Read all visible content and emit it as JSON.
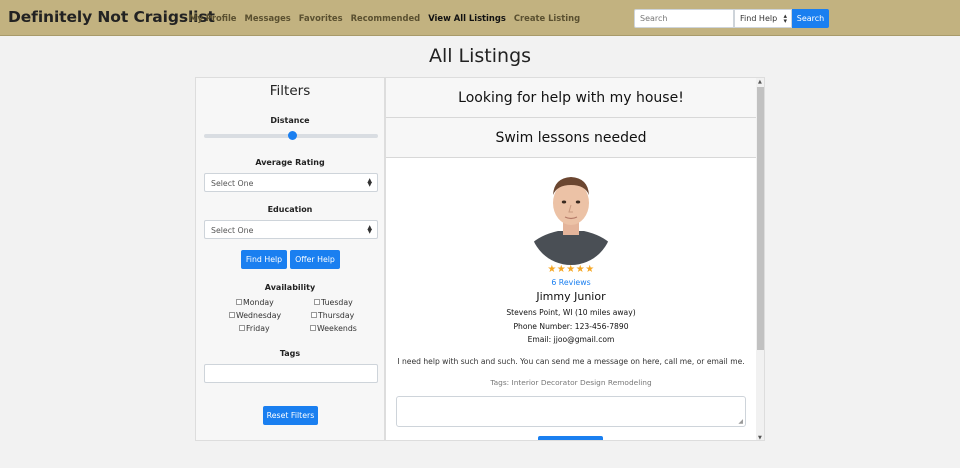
{
  "nav": {
    "brand": "Definitely Not Craigslist",
    "links": [
      "My Profile",
      "Messages",
      "Favorites",
      "Recommended",
      "View All Listings",
      "Create Listing"
    ],
    "active_link": "View All Listings",
    "search_placeholder": "Search",
    "search_type": "Find Help",
    "search_button": "Search",
    "bar_color": "#c2b280",
    "accent_color": "#1a7ff0"
  },
  "page_title": "All Listings",
  "filters": {
    "title": "Filters",
    "distance_label": "Distance",
    "distance_level": 0.5,
    "rating_label": "Average Rating",
    "rating_value": "Select One",
    "education_label": "Education",
    "education_value": "Select One",
    "find_help_button": "Find Help",
    "offer_help_button": "Offer Help",
    "availability_label": "Availability",
    "days": [
      "Monday",
      "Tuesday",
      "Wednesday",
      "Thursday",
      "Friday",
      "Weekends"
    ],
    "tags_label": "Tags",
    "tags_value": "",
    "reset_button": "Reset Filters"
  },
  "listings": {
    "items": [
      {
        "title": "Looking for help with my house!"
      },
      {
        "title": "Swim lessons needed"
      }
    ],
    "detail": {
      "stars": "★★★★★",
      "reviews": "6 Reviews",
      "name": "Jimmy Junior",
      "location": "Stevens Point, WI (10 miles away)",
      "phone": "Phone Number: 123-456-7890",
      "email": "Email: jjoo@gmail.com",
      "description": "I need help with such and such. You can send me a message on here, call me, or email me.",
      "tags": "Tags: Interior Decorator Design Remodeling",
      "message_value": ""
    }
  }
}
